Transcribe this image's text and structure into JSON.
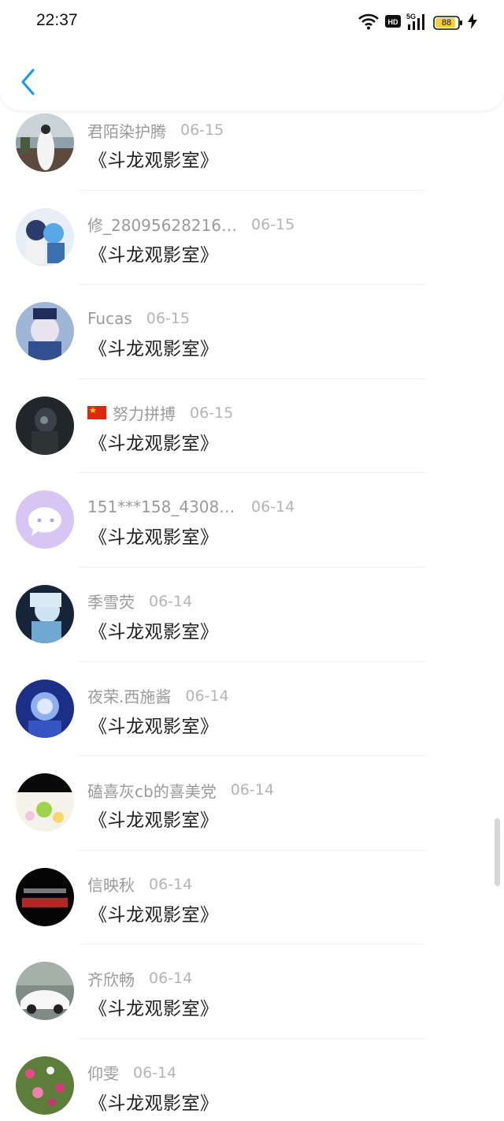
{
  "status_bar": {
    "time": "22:37",
    "network_label": "5G",
    "hd_label": "HD",
    "battery_level": "88",
    "icons": [
      "wifi-icon",
      "hd-icon",
      "signal-icon",
      "battery-icon",
      "charging-icon"
    ]
  },
  "header": {
    "back_icon": "chevron-left-icon",
    "accent_color": "#1e9be6"
  },
  "list": [
    {
      "name": "君陌染护腾",
      "date": "06-15",
      "text": "《斗龙观影室》",
      "flag": false
    },
    {
      "name": "修_280956282160...",
      "date": "06-15",
      "text": "《斗龙观影室》",
      "flag": false
    },
    {
      "name": "Fucas",
      "date": "06-15",
      "text": "《斗龙观影室》",
      "flag": false
    },
    {
      "name": "努力拼搏",
      "date": "06-15",
      "text": "《斗龙观影室》",
      "flag": true
    },
    {
      "name": "151***158_43083...",
      "date": "06-14",
      "text": "《斗龙观影室》",
      "flag": false
    },
    {
      "name": "季雪荧",
      "date": "06-14",
      "text": "《斗龙观影室》",
      "flag": false
    },
    {
      "name": "夜荣.西施酱",
      "date": "06-14",
      "text": "《斗龙观影室》",
      "flag": false
    },
    {
      "name": "磕喜灰cb的喜美党",
      "date": "06-14",
      "text": "《斗龙观影室》",
      "flag": false
    },
    {
      "name": "信映秋",
      "date": "06-14",
      "text": "《斗龙观影室》",
      "flag": false
    },
    {
      "name": "齐欣畅",
      "date": "06-14",
      "text": "《斗龙观影室》",
      "flag": false
    },
    {
      "name": "仰雯",
      "date": "06-14",
      "text": "《斗龙观影室》",
      "flag": false
    }
  ]
}
